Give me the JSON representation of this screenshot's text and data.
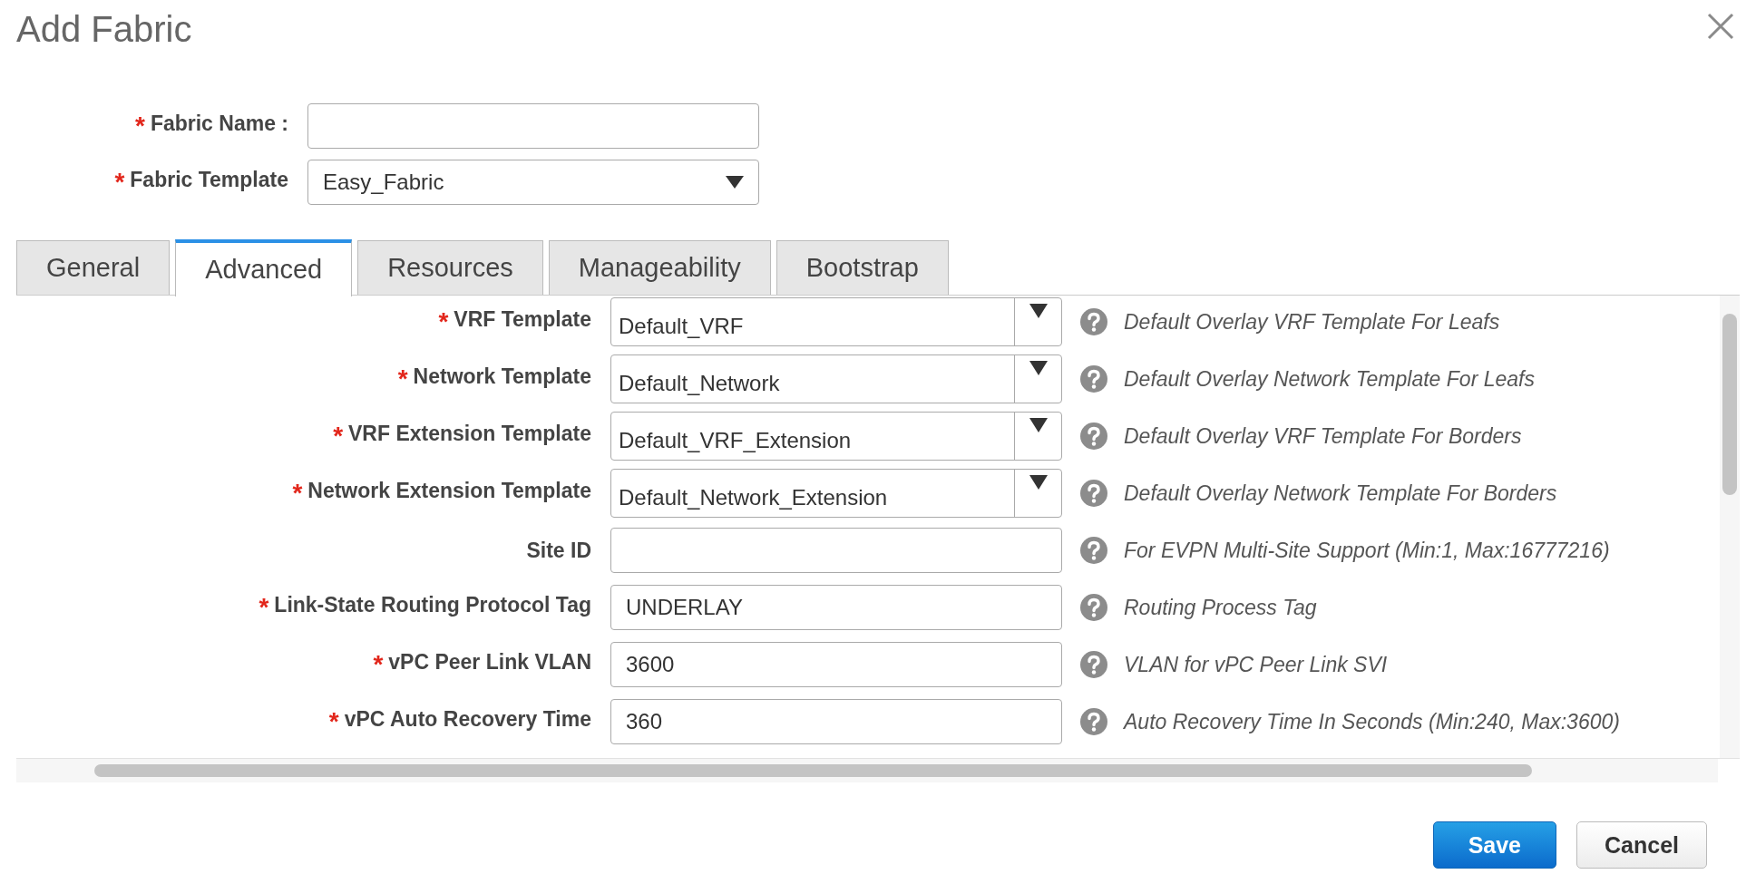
{
  "dialog": {
    "title": "Add Fabric"
  },
  "top_fields": [
    {
      "kind": "input",
      "required_mark": "*",
      "label": "Fabric Name :"
    },
    {
      "kind": "select",
      "required_mark": "*",
      "label": "Fabric Template",
      "value": "Easy_Fabric"
    }
  ],
  "tabs": [
    {
      "label": "General",
      "selected": false
    },
    {
      "label": "Advanced",
      "selected": true
    },
    {
      "label": "Resources",
      "selected": false
    },
    {
      "label": "Manageability",
      "selected": false
    },
    {
      "label": "Bootstrap",
      "selected": false
    }
  ],
  "rows": [
    {
      "kind": "select",
      "required_mark": "*",
      "label": "VRF Template",
      "value": "Default_VRF",
      "help": "Default Overlay VRF Template For Leafs"
    },
    {
      "kind": "select",
      "required_mark": "*",
      "label": "Network Template",
      "value": "Default_Network",
      "help": "Default Overlay Network Template For Leafs"
    },
    {
      "kind": "select",
      "required_mark": "*",
      "label": "VRF Extension Template",
      "value": "Default_VRF_Extension",
      "help": "Default Overlay VRF Template For Borders"
    },
    {
      "kind": "select",
      "required_mark": "*",
      "label": "Network Extension Template",
      "value": "Default_Network_Extension",
      "help": "Default Overlay Network Template For Borders"
    },
    {
      "kind": "input",
      "label": "Site ID",
      "help": "For EVPN Multi-Site Support (Min:1, Max:16777216)"
    },
    {
      "kind": "input",
      "required_mark": "*",
      "label": "Link-State Routing Protocol Tag",
      "value": "UNDERLAY",
      "help": "Routing Process Tag"
    },
    {
      "kind": "input",
      "required_mark": "*",
      "label": "vPC Peer Link VLAN",
      "value": "3600",
      "help": "VLAN for vPC Peer Link SVI"
    },
    {
      "kind": "input",
      "required_mark": "*",
      "label": "vPC Auto Recovery Time",
      "value": "360",
      "help": "Auto Recovery Time In Seconds (Min:240, Max:3600)"
    }
  ],
  "buttons": [
    {
      "kind": "primary",
      "label": "Save"
    },
    {
      "kind": "secondary",
      "label": "Cancel"
    }
  ]
}
